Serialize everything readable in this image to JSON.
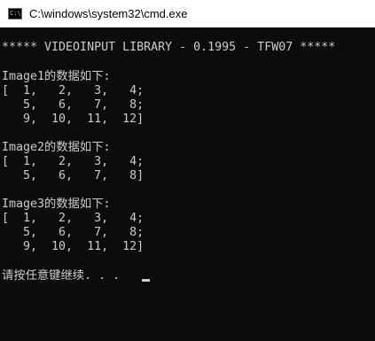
{
  "window": {
    "title": "C:\\windows\\system32\\cmd.exe",
    "icon": "cmd-icon",
    "icon_text": "C:\\"
  },
  "console": {
    "lines": [
      "***** VIDEOINPUT LIBRARY - 0.1995 - TFW07 *****",
      "Image1的数据如下:",
      "[  1,   2,   3,   4;",
      "   5,   6,   7,   8;",
      "   9,  10,  11,  12]",
      "Image2的数据如下:",
      "[  1,   2,   3,   4;",
      "   5,   6,   7,   8]",
      "Image3的数据如下:",
      "[  1,   2,   3,   4;",
      "   5,   6,   7,   8;",
      "   9,  10,  11,  12]",
      "请按任意键继续. . ."
    ]
  },
  "colors": {
    "background": "#0c0c0c",
    "text": "#cccccc",
    "titlebar": "#ffffff"
  }
}
